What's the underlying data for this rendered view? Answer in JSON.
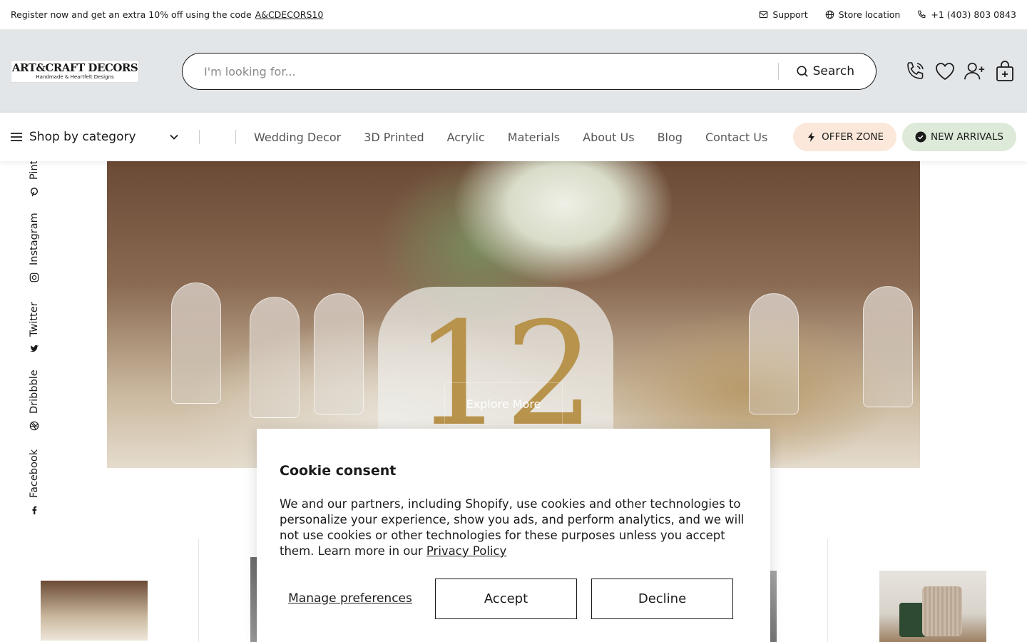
{
  "topbar": {
    "promo_text": "Register now and get an extra 10% off using the code",
    "promo_code": "A&CDECORS10",
    "support_label": "Support",
    "store_label": "Store location",
    "phone_label": "+1 (403) 803 0843"
  },
  "header": {
    "logo_main": "ART&CRAFT DECORS",
    "logo_sub": "Handmade & Heartfelt Designs",
    "search_placeholder": "I'm looking for...",
    "search_button": "Search"
  },
  "nav": {
    "shop_by_category": "Shop by category",
    "links": [
      "Wedding Decor",
      "3D Printed",
      "Acrylic",
      "Materials",
      "About Us",
      "Blog",
      "Contact Us"
    ],
    "offer_zone": "OFFER ZONE",
    "new_arrivals": "NEW ARRIVALS"
  },
  "social": {
    "items": [
      "Pinterest",
      "Instagram",
      "Twitter",
      "Dribbble",
      "Facebook"
    ],
    "pinterest_visible": "Pint"
  },
  "hero": {
    "number": "12",
    "explore_label": "Explore More"
  },
  "cookie": {
    "title": "Cookie consent",
    "body": "We and our partners, including Shopify, use cookies and other technologies to personalize your experience, show you ads, and perform analytics, and we will not use cookies or other technologies for these purposes unless you accept them. Learn more in our",
    "privacy_link": "Privacy Policy",
    "manage_label": "Manage preferences",
    "accept_label": "Accept",
    "decline_label": "Decline"
  },
  "colors": {
    "header_bg": "#e3e6e9",
    "offer_bg": "#fbe8da",
    "new_bg": "#dde9d9"
  }
}
